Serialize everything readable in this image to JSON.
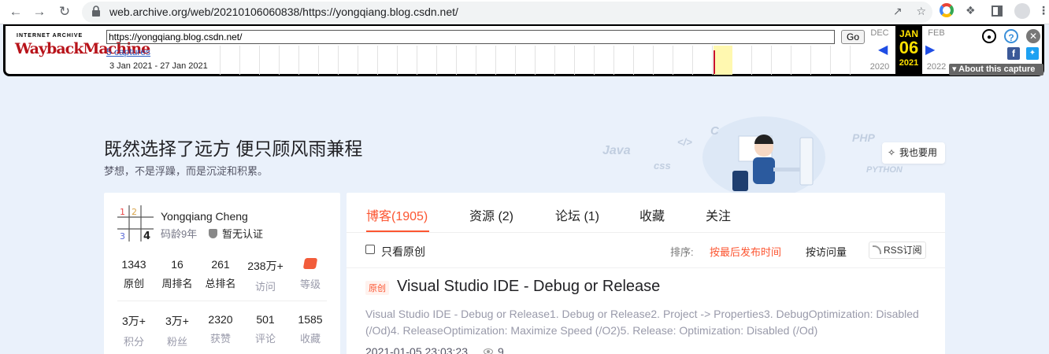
{
  "browser": {
    "url": "web.archive.org/web/20210106060838/https://yongqiang.blog.csdn.net/",
    "back_icon": "arrow-left-icon",
    "forward_icon": "arrow-right-icon",
    "reload_icon": "reload-icon"
  },
  "wayback": {
    "logo_top": "INTERNET ARCHIVE",
    "logo": "WaybackMachine",
    "url_value": "https://yongqiang.blog.csdn.net/",
    "go_label": "Go",
    "captures_link": "5 captures",
    "date_range": "3 Jan 2021 - 27 Jan 2021",
    "prev_month": "DEC",
    "prev_year": "2020",
    "cur_month": "JAN",
    "cur_day": "06",
    "cur_year": "2021",
    "next_month": "FEB",
    "next_year": "2022",
    "about_label": "▾ About this capture"
  },
  "banner": {
    "title": "既然选择了远方 便只顾风雨兼程",
    "subtitle": "梦想，不是浮躁，而是沉淀和积累。",
    "wish_button": "我也要用"
  },
  "profile": {
    "name": "Yongqiang Cheng",
    "age": "码龄9年",
    "verify": "暂无认证",
    "stats_row1": [
      {
        "value": "1343",
        "label": "原创"
      },
      {
        "value": "16",
        "label": "周排名"
      },
      {
        "value": "261",
        "label": "总排名"
      },
      {
        "value": "238万+",
        "label": "访问"
      },
      {
        "value": "",
        "label": "等级"
      }
    ],
    "stats_row2": [
      {
        "value": "3万+",
        "label": "积分"
      },
      {
        "value": "3万+",
        "label": "粉丝"
      },
      {
        "value": "2320",
        "label": "获赞"
      },
      {
        "value": "501",
        "label": "评论"
      },
      {
        "value": "1585",
        "label": "收藏"
      }
    ]
  },
  "tabs": [
    {
      "label": "博客(1905)"
    },
    {
      "label": "资源 (2)"
    },
    {
      "label": "论坛 (1)"
    },
    {
      "label": "收藏"
    },
    {
      "label": "关注"
    }
  ],
  "filter": {
    "only_original": "只看原创",
    "sort_label": "排序:",
    "sort_latest": "按最后发布时间",
    "sort_views": "按访问量",
    "rss": "RSS订阅"
  },
  "article": {
    "badge": "原创",
    "title": "Visual Studio IDE - Debug or Release",
    "desc": "Visual Studio IDE - Debug or Release1. Debug or Release2. Project -> Properties3. DebugOptimization: Disabled (/Od)4. ReleaseOptimization: Maximize Speed (/O2)5. Release: Optimization: Disabled (/Od)",
    "date": "2021-01-05 23:03:23",
    "views": "9"
  }
}
